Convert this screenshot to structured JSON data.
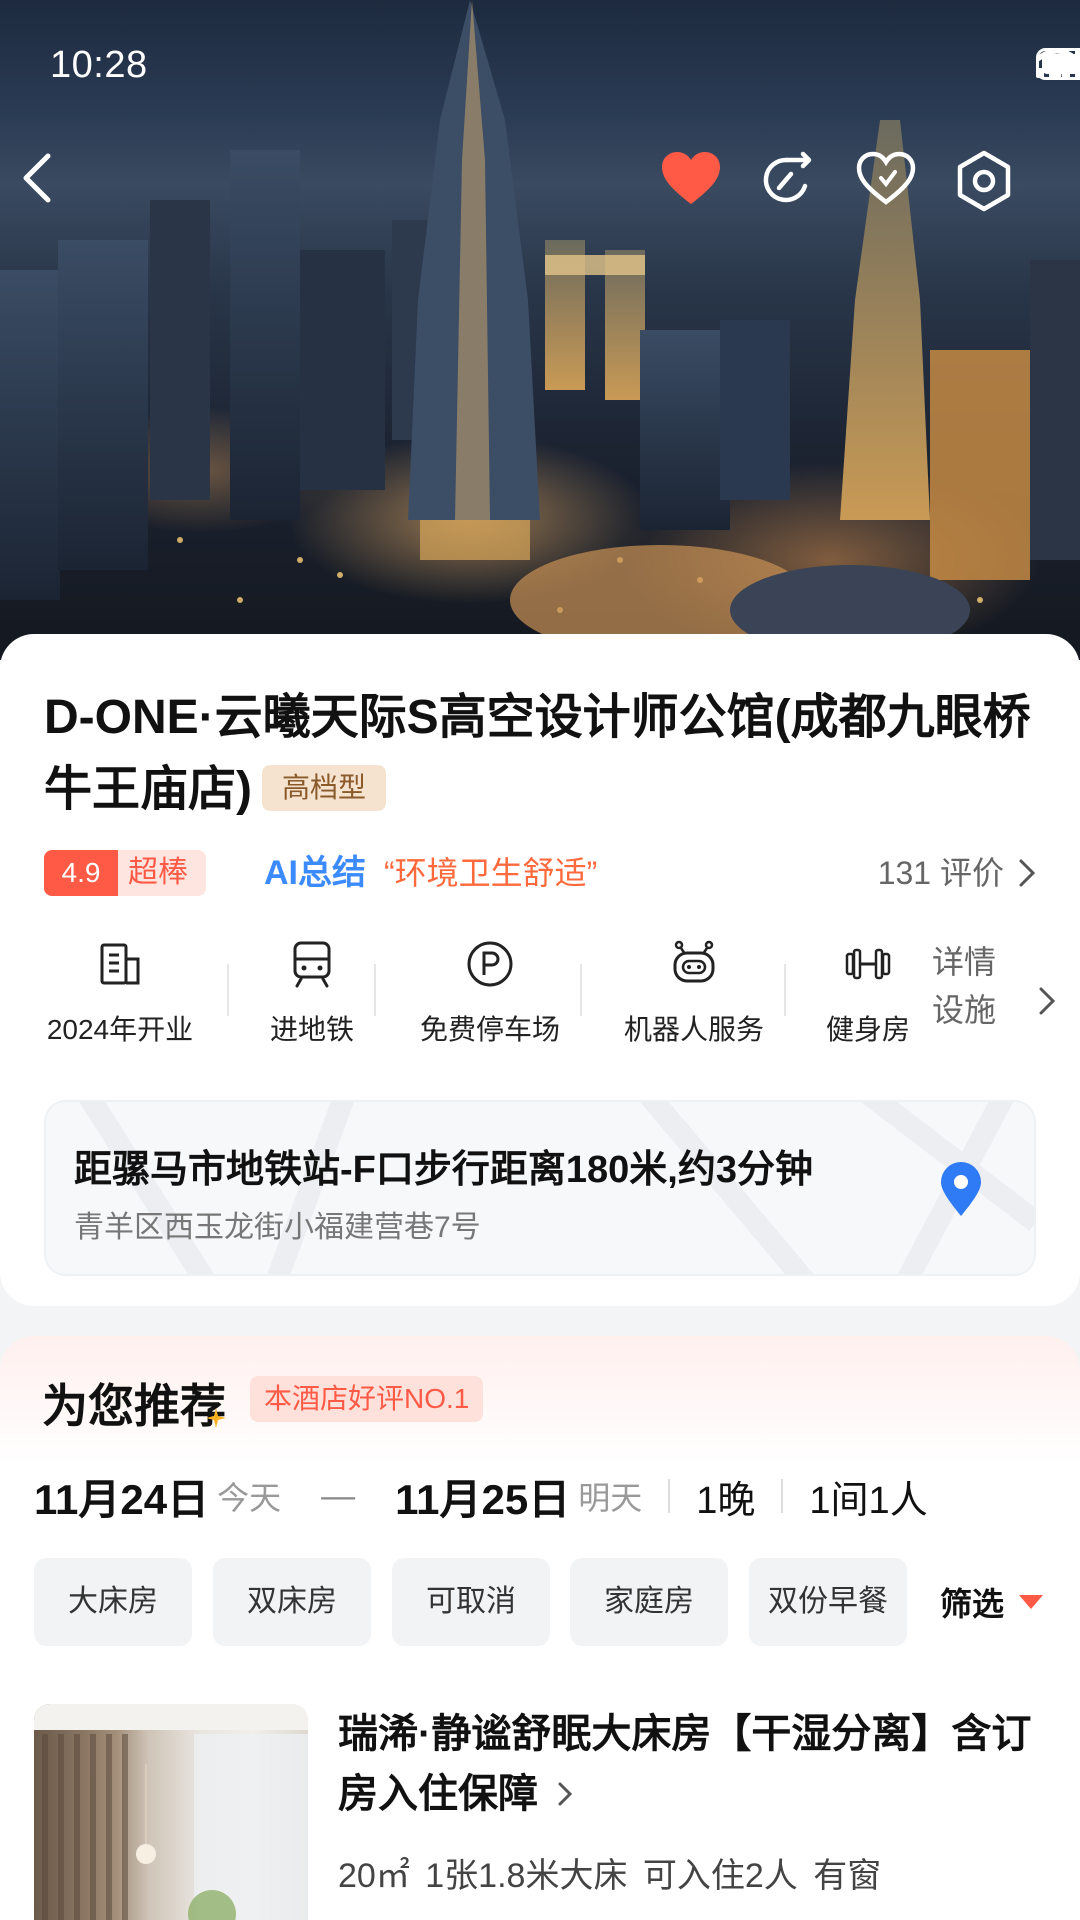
{
  "status": {
    "time": "10:28"
  },
  "hotel": {
    "name": "D-ONE·云曦天际S高空设计师公馆(成都九眼桥牛王庙店)",
    "level_tag": "高档型",
    "score": "4.9",
    "score_word": "超棒",
    "ai_label": "AI总结",
    "ai_quote": "“环境卫生舒适”",
    "reviews": "131 评价"
  },
  "facilities": {
    "items": [
      {
        "label": "2024年开业",
        "icon": "building-icon"
      },
      {
        "label": "进地铁",
        "icon": "subway-icon"
      },
      {
        "label": "免费停车场",
        "icon": "parking-icon"
      },
      {
        "label": "机器人服务",
        "icon": "robot-icon"
      },
      {
        "label": "健身房",
        "icon": "dumbbell-icon"
      }
    ],
    "detail_label_1": "详情",
    "detail_label_2": "设施"
  },
  "location": {
    "distance": "距骡马市地铁站-F口步行距离180米,约3分钟",
    "address": "青羊区西玉龙街小福建营巷7号"
  },
  "recommend": {
    "title": "为您推荐",
    "badge": "本酒店好评NO.1",
    "checkin_date": "11月24日",
    "checkin_day": "今天",
    "dash": "—",
    "checkout_date": "11月25日",
    "checkout_day": "明天",
    "nights": "1晚",
    "rooms_people": "1间1人",
    "chips": [
      "大床房",
      "双床房",
      "可取消",
      "家庭房",
      "双份早餐"
    ],
    "filter_label": "筛选"
  },
  "room": {
    "name": "瑞浠·静谧舒眠大床房【干湿分离】含订房入住保障",
    "spec": "20㎡  1张1.8米大床  可入住2人 有窗"
  },
  "colors": {
    "accent": "#ff5a45",
    "ai_blue": "#3b8bff",
    "pin_blue": "#2f7bf5"
  }
}
